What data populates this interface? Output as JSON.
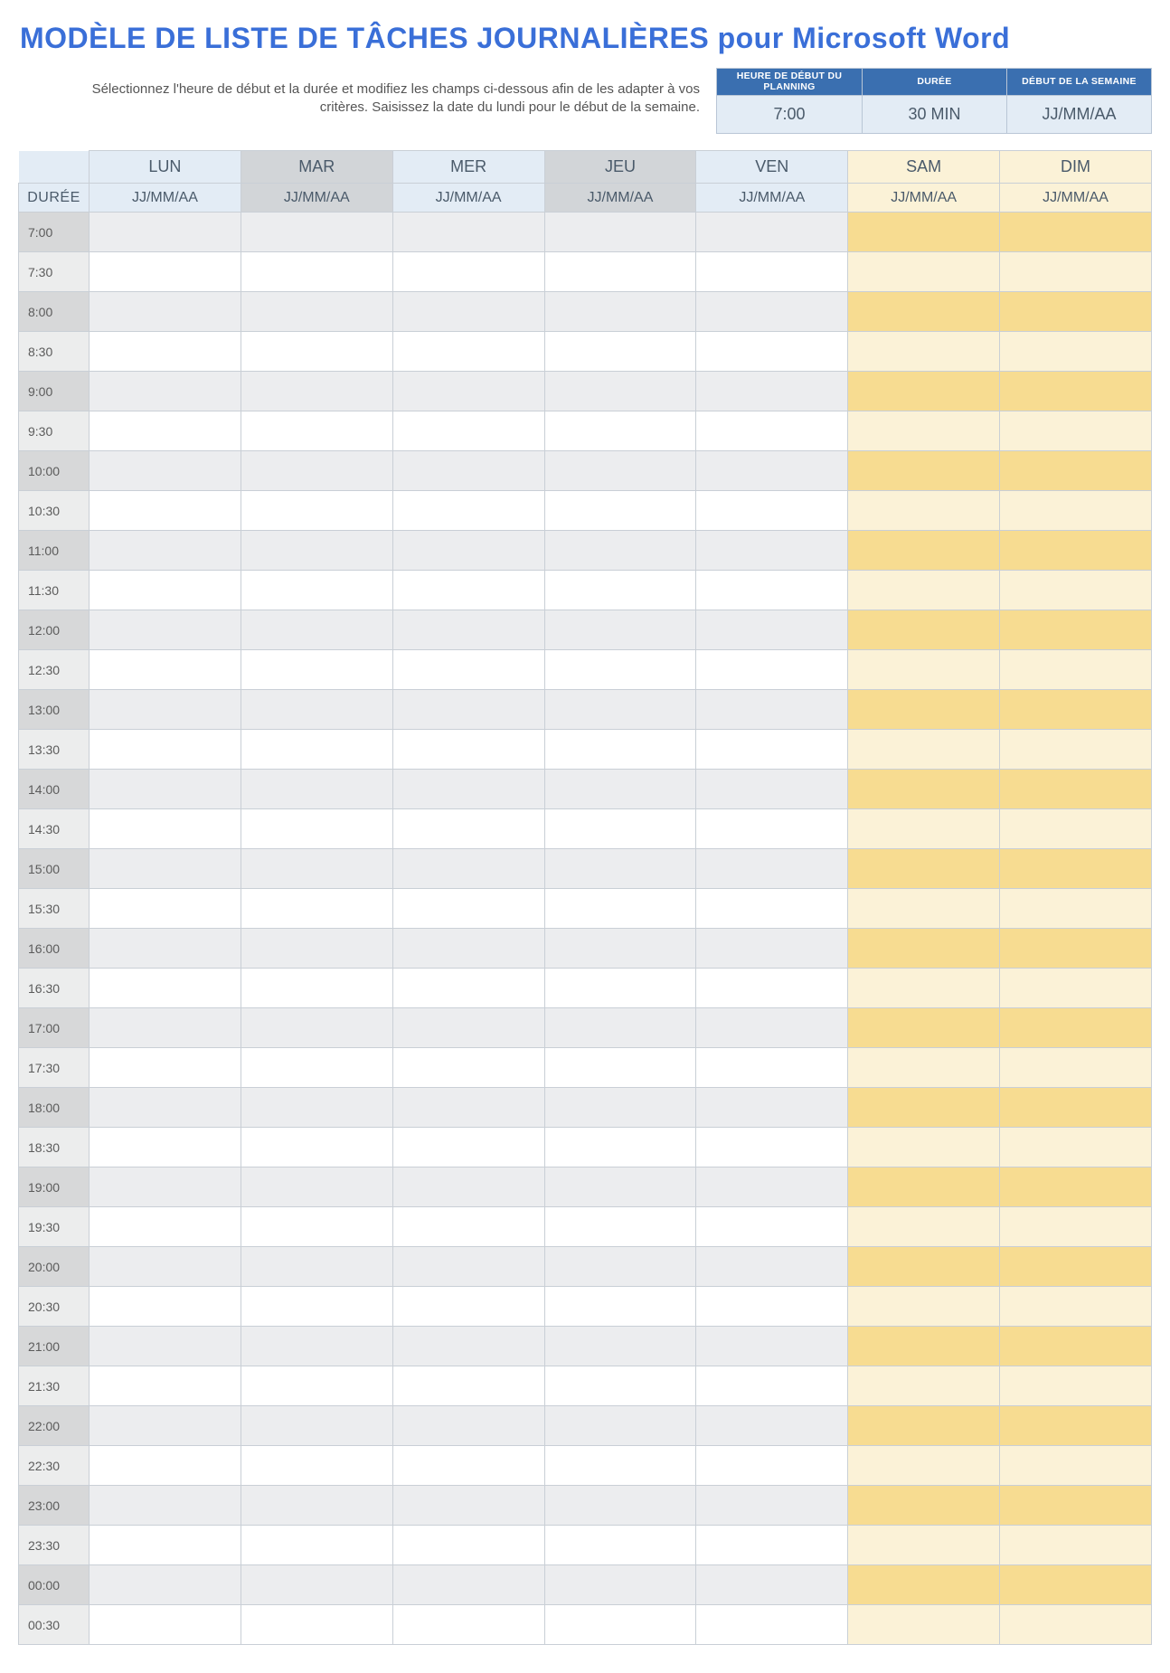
{
  "title": "MODÈLE DE LISTE DE TÂCHES JOURNALIÈRES pour Microsoft Word",
  "instructions": "Sélectionnez l'heure de début et la durée et modifiez les champs ci-dessous afin de les adapter à vos critères. Saisissez la date du lundi pour le début de la semaine.",
  "config": [
    {
      "label": "HEURE DE DÉBUT DU PLANNING",
      "value": "7:00"
    },
    {
      "label": "DURÉE",
      "value": "30 MIN"
    },
    {
      "label": "DÉBUT DE LA SEMAINE",
      "value": "JJ/MM/AA"
    }
  ],
  "duree_label": "DURÉE",
  "days": [
    {
      "name": "LUN",
      "date": "JJ/MM/AA",
      "type": "wd",
      "alt": false
    },
    {
      "name": "MAR",
      "date": "JJ/MM/AA",
      "type": "wd",
      "alt": true
    },
    {
      "name": "MER",
      "date": "JJ/MM/AA",
      "type": "wd",
      "alt": false
    },
    {
      "name": "JEU",
      "date": "JJ/MM/AA",
      "type": "wd",
      "alt": true
    },
    {
      "name": "VEN",
      "date": "JJ/MM/AA",
      "type": "wd",
      "alt": false
    },
    {
      "name": "SAM",
      "date": "JJ/MM/AA",
      "type": "we",
      "alt": false
    },
    {
      "name": "DIM",
      "date": "JJ/MM/AA",
      "type": "we",
      "alt": false
    }
  ],
  "times": [
    "7:00",
    "7:30",
    "8:00",
    "8:30",
    "9:00",
    "9:30",
    "10:00",
    "10:30",
    "11:00",
    "11:30",
    "12:00",
    "12:30",
    "13:00",
    "13:30",
    "14:00",
    "14:30",
    "15:00",
    "15:30",
    "16:00",
    "16:30",
    "17:00",
    "17:30",
    "18:00",
    "18:30",
    "19:00",
    "19:30",
    "20:00",
    "20:30",
    "21:00",
    "21:30",
    "22:00",
    "22:30",
    "23:00",
    "23:30",
    "00:00",
    "00:30"
  ]
}
